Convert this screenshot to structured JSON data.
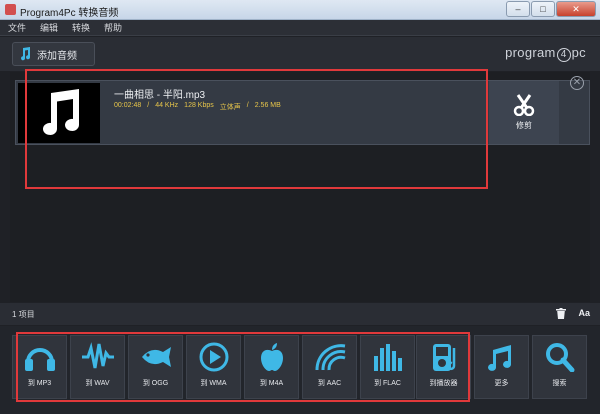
{
  "window": {
    "title": "Program4Pc 转换音频",
    "buttons": [
      "–",
      "□",
      "✕"
    ]
  },
  "menu": [
    "文件",
    "编辑",
    "转换",
    "帮助"
  ],
  "toolbar": {
    "add_audio_label": "添加音频",
    "brand_pre": "program",
    "brand_mid": "4",
    "brand_post": "pc"
  },
  "file": {
    "name": "一曲相思  - 半阳.mp3",
    "duration": "00:02:48",
    "sample_rate": "44 KHz",
    "bitrate": "128 Kbps",
    "channels": "立体声",
    "size": "2.56 MB",
    "trim_label": "修剪"
  },
  "status": {
    "count": "1 项目",
    "font_btn": "Aa"
  },
  "converters": [
    {
      "label": "到 MP3",
      "icon": "headphones-icon"
    },
    {
      "label": "到 WAV",
      "icon": "waveform-icon"
    },
    {
      "label": "到 OGG",
      "icon": "fish-icon"
    },
    {
      "label": "到 WMA",
      "icon": "play-circle-icon"
    },
    {
      "label": "到 M4A",
      "icon": "apple-icon"
    },
    {
      "label": "到 AAC",
      "icon": "wave-arcs-icon"
    },
    {
      "label": "到 FLAC",
      "icon": "equalizer-icon"
    },
    {
      "label": "到播放器",
      "icon": "player-icon"
    },
    {
      "label": "更多",
      "icon": "music-notes-icon"
    },
    {
      "label": "搜索",
      "icon": "search-icon"
    }
  ],
  "colors": {
    "accent": "#3fb8e6",
    "meta_text": "#e8c64a",
    "highlight": "#e0393b"
  }
}
